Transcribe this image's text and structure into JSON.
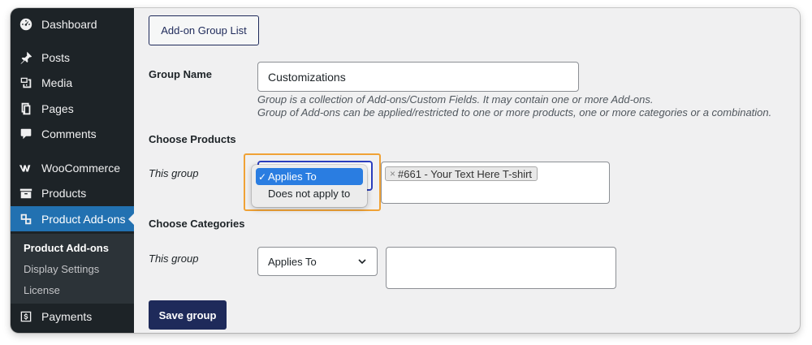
{
  "sidebar": {
    "items": [
      {
        "label": "Dashboard",
        "icon": "dashboard-icon"
      },
      {
        "label": "Posts",
        "icon": "pin-icon"
      },
      {
        "label": "Media",
        "icon": "media-icon"
      },
      {
        "label": "Pages",
        "icon": "pages-icon"
      },
      {
        "label": "Comments",
        "icon": "comment-icon"
      },
      {
        "label": "WooCommerce",
        "icon": "woocommerce-icon"
      },
      {
        "label": "Products",
        "icon": "archive-icon"
      },
      {
        "label": "Product Add-ons",
        "icon": "addons-icon"
      },
      {
        "label": "Payments",
        "icon": "payments-icon"
      }
    ],
    "submenu": [
      {
        "label": "Product Add-ons"
      },
      {
        "label": "Display Settings"
      },
      {
        "label": "License"
      }
    ]
  },
  "main": {
    "list_button": "Add-on Group List",
    "group_name_label": "Group Name",
    "group_name_value": "Customizations",
    "desc_line1": "Group is a collection of Add-ons/Custom Fields. It may contain one or more Add-ons.",
    "desc_line2": "Group of Add-ons can be applied/restricted to one or more products, one or more categories or a combination.",
    "choose_products_label": "Choose Products",
    "this_group_label_products": "This group",
    "dropdown_options": [
      {
        "label": "Applies To",
        "selected": true
      },
      {
        "label": "Does not apply to",
        "selected": false
      }
    ],
    "dropdown_check": "✓",
    "product_tag": "#661 - Your Text Here T-shirt",
    "tag_remove": "×",
    "choose_categories_label": "Choose Categories",
    "this_group_label_categories": "This group",
    "categories_select_value": "Applies To",
    "save_button": "Save group"
  },
  "colors": {
    "sidebar_bg": "#1d2327",
    "active_menu": "#2271b1",
    "primary_button": "#1e2a5a",
    "highlight": "#f0a236",
    "dropdown_selected": "#2a7de1"
  }
}
